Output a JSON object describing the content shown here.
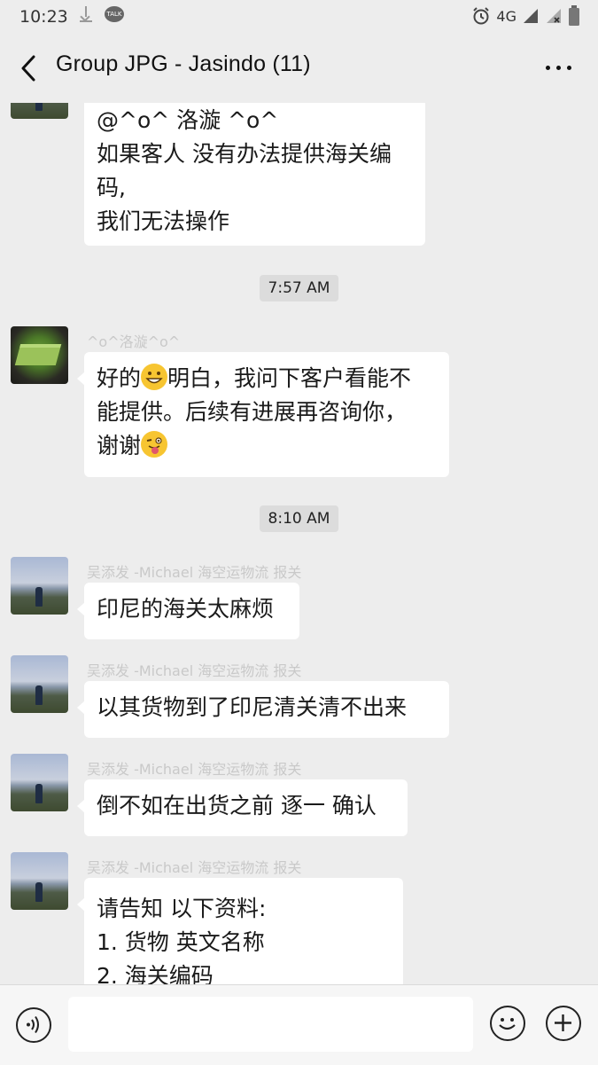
{
  "status_bar": {
    "time": "10:23",
    "network": "4G",
    "icons": [
      "download-icon",
      "kakaotalk-icon",
      "alarm-icon",
      "signal-icon",
      "signal-no-sim-icon",
      "battery-icon"
    ],
    "talk_label": "TALK"
  },
  "header": {
    "title": "Group JPG - Jasindo (11)",
    "back_icon": "back-arrow-icon",
    "more_icon": "more-options-icon"
  },
  "messages": [
    {
      "sender": "",
      "avatar": "landscape-avatar",
      "lines": [
        "@^o^ 洛漩 ^o^",
        "如果客人 没有办法提供海关编",
        "码,",
        "我们无法操作"
      ]
    },
    {
      "timestamp": "7:57 AM"
    },
    {
      "sender": "^o^洛漩^o^",
      "avatar": "cake-avatar",
      "lines": [
        "好的",
        "明白，我问下客户看能不",
        "能提供。后续有进展再咨询你，",
        "谢谢"
      ]
    },
    {
      "timestamp": "8:10 AM"
    },
    {
      "sender": "吴添发 -Michael 海空运物流 报关",
      "avatar": "landscape-avatar",
      "lines": [
        "印尼的海关太麻烦"
      ]
    },
    {
      "sender": "吴添发 -Michael 海空运物流 报关",
      "avatar": "landscape-avatar",
      "lines": [
        "以其货物到了印尼清关清不出来"
      ]
    },
    {
      "sender": "吴添发 -Michael 海空运物流 报关",
      "avatar": "landscape-avatar",
      "lines": [
        "倒不如在出货之前 逐一 确认"
      ]
    },
    {
      "sender": "吴添发 -Michael 海空运物流 报关",
      "avatar": "landscape-avatar",
      "lines": [
        "请告知 以下资料:",
        "1.  货物 英文名称",
        "2.  海关编码"
      ]
    }
  ],
  "input_bar": {
    "voice_icon": "voice-input-icon",
    "emoji_icon": "emoji-icon",
    "plus_icon": "plus-icon",
    "input_value": ""
  },
  "colors": {
    "background": "#ededed",
    "bubble": "#ffffff",
    "sender_name": "#c9c9c9",
    "timestamp_bg": "#dcdcdc"
  }
}
